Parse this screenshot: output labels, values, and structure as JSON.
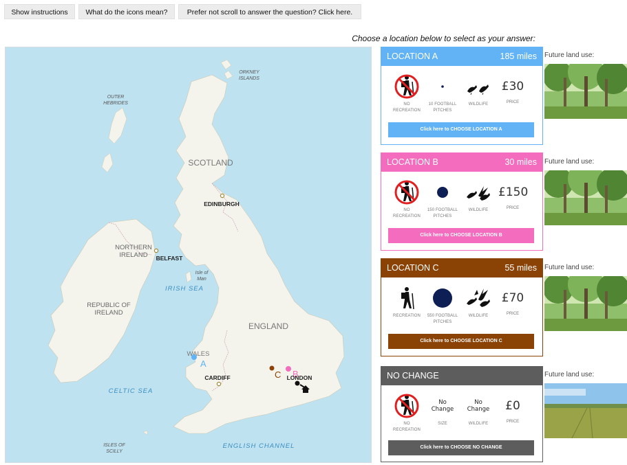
{
  "toolbar": {
    "instructions": "Show instructions",
    "icons_meaning": "What do the icons mean?",
    "no_scroll": "Prefer not scroll to answer the question? Click here."
  },
  "prompt": "Choose a location below to select as your answer:",
  "map": {
    "labels": {
      "orkney": [
        "ORKNEY",
        "ISLANDS"
      ],
      "outer_hebrides": [
        "OUTER",
        "HEBRIDES"
      ],
      "scotland": "SCOTLAND",
      "edinburgh": "EDINBURGH",
      "northern_ireland": [
        "NORTHERN",
        "IRELAND"
      ],
      "belfast": "BELFAST",
      "isle_of_man": [
        "Isle of",
        "Man"
      ],
      "irish_sea": "IRISH SEA",
      "republic_of_ireland": [
        "REPUBLIC OF",
        "IRELAND"
      ],
      "england": "ENGLAND",
      "wales": "WALES",
      "cardiff": "CARDIFF",
      "london": "LONDON",
      "celtic_sea": "CELTIC SEA",
      "english_channel": "ENGLISH CHANNEL",
      "isles_of_scilly": [
        "ISLES OF",
        "SCILLY"
      ]
    },
    "markers": {
      "a": "A",
      "b": "B",
      "c": "C"
    }
  },
  "locations": [
    {
      "title": "LOCATION A",
      "distance": "185 miles",
      "color": "#62b3f5",
      "recreation_label": "NO RECREATION",
      "recreation_allowed": false,
      "pitches_label": "10 FOOTBALL PITCHES",
      "wildlife_label": "WILDLIFE",
      "price": "£30",
      "price_label": "PRICE",
      "button": "Click here to CHOOSE LOCATION A",
      "future_label": "Future land use:",
      "future_use": "woodland-photo"
    },
    {
      "title": "LOCATION B",
      "distance": "30 miles",
      "color": "#f46cbd",
      "recreation_label": "NO RECREATION",
      "recreation_allowed": false,
      "pitches_label": "150 FOOTBALL PITCHES",
      "wildlife_label": "WILDLIFE",
      "price": "£150",
      "price_label": "PRICE",
      "button": "Click here to CHOOSE LOCATION B",
      "future_label": "Future land use:",
      "future_use": "woodland-photo"
    },
    {
      "title": "LOCATION C",
      "distance": "55 miles",
      "color": "#8a4305",
      "recreation_label": "RECREATION",
      "recreation_allowed": true,
      "pitches_label": "550 FOOTBALL PITCHES",
      "wildlife_label": "WILDLIFE",
      "price": "£70",
      "price_label": "PRICE",
      "button": "Click here to CHOOSE LOCATION C",
      "future_label": "Future land use:",
      "future_use": "woodland-photo"
    },
    {
      "title": "NO CHANGE",
      "distance": "",
      "color": "#5d5d5d",
      "recreation_label": "NO RECREATION",
      "recreation_allowed": false,
      "size_value": [
        "No",
        "Change"
      ],
      "size_label": "SIZE",
      "wildlife_value": [
        "No",
        "Change"
      ],
      "wildlife_label": "WILDLIFE",
      "price": "£0",
      "price_label": "PRICE",
      "button": "Click here to CHOOSE NO CHANGE",
      "future_label": "Future land use:",
      "future_use": "farmland-photo"
    }
  ]
}
